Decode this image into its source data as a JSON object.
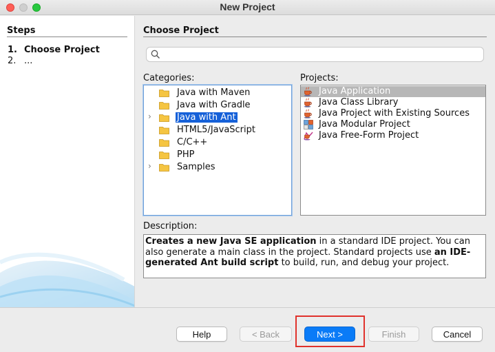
{
  "window": {
    "title": "New Project"
  },
  "steps": {
    "title": "Steps",
    "items": [
      {
        "num": "1.",
        "label": "Choose Project"
      },
      {
        "num": "2.",
        "label": "..."
      }
    ]
  },
  "main": {
    "title": "Choose Project",
    "search": {
      "placeholder": "",
      "value": ""
    },
    "categories_label": "Categories:",
    "projects_label": "Projects:",
    "description_label": "Description:"
  },
  "categories": [
    {
      "label": "Java with Maven",
      "expandable": false,
      "selected": false
    },
    {
      "label": "Java with Gradle",
      "expandable": false,
      "selected": false
    },
    {
      "label": "Java with Ant",
      "expandable": true,
      "selected": true
    },
    {
      "label": "HTML5/JavaScript",
      "expandable": false,
      "selected": false
    },
    {
      "label": "C/C++",
      "expandable": false,
      "selected": false
    },
    {
      "label": "PHP",
      "expandable": false,
      "selected": false
    },
    {
      "label": "Samples",
      "expandable": true,
      "selected": false
    }
  ],
  "projects": [
    {
      "label": "Java Application",
      "icon": "java-coffee-cup-icon",
      "selected": true
    },
    {
      "label": "Java Class Library",
      "icon": "java-coffee-cup-icon",
      "selected": false
    },
    {
      "label": "Java Project with Existing Sources",
      "icon": "java-coffee-cup-icon",
      "selected": false
    },
    {
      "label": "Java Modular Project",
      "icon": "java-modular-icon",
      "selected": false
    },
    {
      "label": "Java Free-Form Project",
      "icon": "java-freeform-icon",
      "selected": false
    }
  ],
  "description": {
    "p1": "Creates a new Java SE application",
    "p2": " in a standard IDE project. You can also generate a main class in the project. Standard projects use ",
    "p3": "an IDE-generated Ant build script",
    "p4": " to build, run, and debug your project."
  },
  "buttons": {
    "help": "Help",
    "back": "< Back",
    "next": "Next >",
    "finish": "Finish",
    "cancel": "Cancel"
  },
  "colors": {
    "selection_blue": "#1560d8",
    "default_button": "#0a7bf7",
    "highlight_box": "#e0312b",
    "folder": "#f5c542"
  }
}
